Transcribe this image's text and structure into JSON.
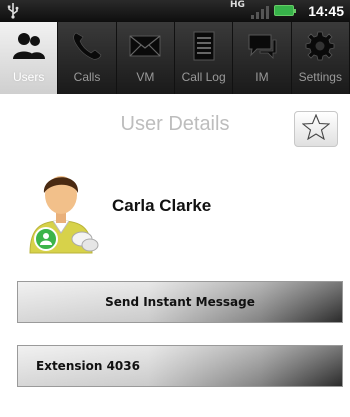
{
  "status_bar": {
    "network": "HG",
    "time": "14:45"
  },
  "tabs": [
    {
      "label": "Users",
      "icon": "users-icon",
      "active": true
    },
    {
      "label": "Calls",
      "icon": "phone-icon",
      "active": false
    },
    {
      "label": "VM",
      "icon": "envelope-icon",
      "active": false
    },
    {
      "label": "Call Log",
      "icon": "call-log-icon",
      "active": false
    },
    {
      "label": "IM",
      "icon": "chat-icon",
      "active": false
    },
    {
      "label": "Settings",
      "icon": "gear-icon",
      "active": false
    }
  ],
  "page": {
    "title": "User Details",
    "favorite_icon": "star-icon"
  },
  "user": {
    "name": "Carla Clarke",
    "avatar_icon": "user-avatar-icon",
    "status_color": "#3cb44a"
  },
  "actions": {
    "send_im_label": "Send Instant Message",
    "extension_label": "Extension 4036"
  }
}
